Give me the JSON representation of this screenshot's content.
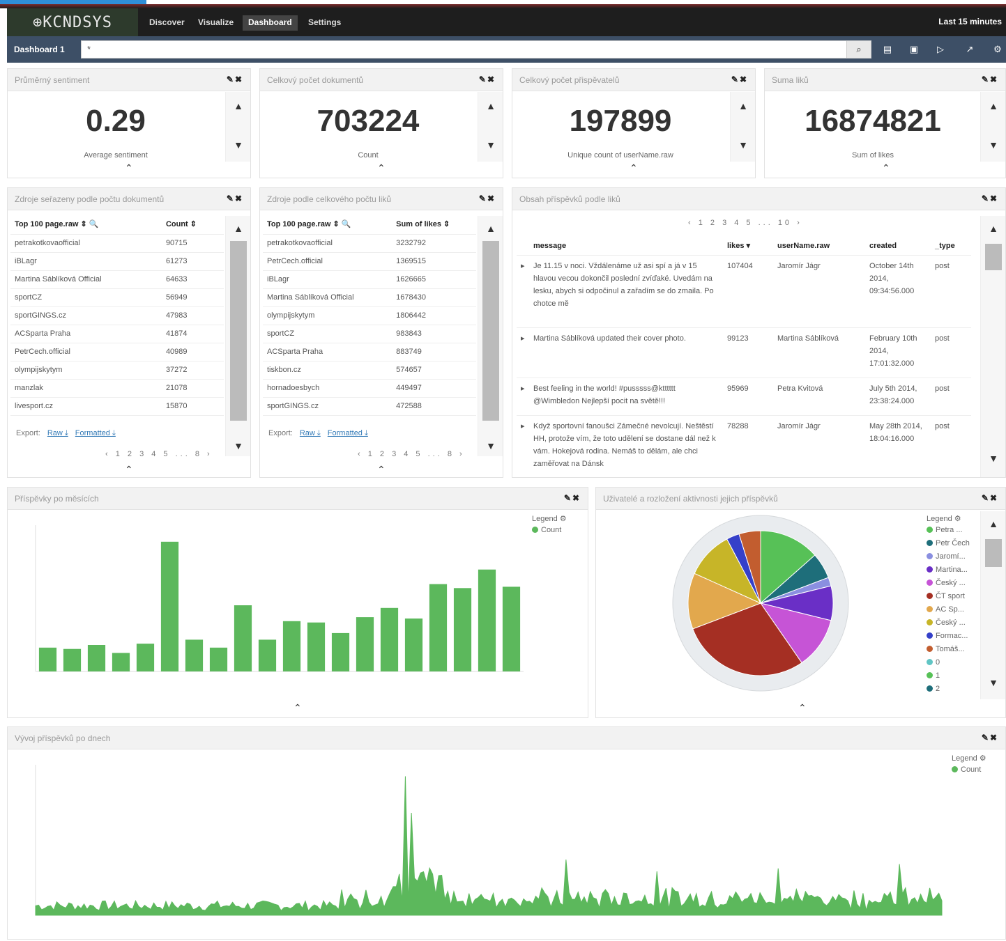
{
  "app": {
    "logo": "⊕KCNDSYS",
    "nav": [
      "Discover",
      "Visualize",
      "Dashboard",
      "Settings"
    ],
    "active_nav": "Dashboard",
    "time_label": "Last 15 minutes",
    "dashboard_name": "Dashboard 1",
    "search_value": "*",
    "toolbar_icons": [
      "new-dashboard-icon",
      "save-icon",
      "load-icon",
      "share-icon",
      "settings-icon"
    ]
  },
  "metrics": [
    {
      "title": "Průměrný sentiment",
      "value": "0.29",
      "label": "Average sentiment"
    },
    {
      "title": "Celkový počet dokumentů",
      "value": "703224",
      "label": "Count"
    },
    {
      "title": "Celkový počet přispěvatelů",
      "value": "197899",
      "label": "Unique count of userName.raw"
    },
    {
      "title": "Suma liků",
      "value": "16874821",
      "label": "Sum of likes"
    }
  ],
  "sources_by_docs": {
    "title": "Zdroje seřazeny podle počtu dokumentů",
    "columns": [
      "Top 100 page.raw ⇕ 🔍",
      "Count ⇕"
    ],
    "rows": [
      [
        "petrakotkovaofficial",
        "90715"
      ],
      [
        "iBLagr",
        "61273"
      ],
      [
        "Martina Sáblíková Official",
        "64633"
      ],
      [
        "sportCZ",
        "56949"
      ],
      [
        "sportGINGS.cz",
        "47983"
      ],
      [
        "ACSparta Praha",
        "41874"
      ],
      [
        "PetrCech.official",
        "40989"
      ],
      [
        "olympijskytym",
        "37272"
      ],
      [
        "manzlak",
        "21078"
      ],
      [
        "livesport.cz",
        "15870"
      ]
    ],
    "export_label": "Export:",
    "export_links": [
      "Raw ⤓",
      "Formatted ⤓"
    ],
    "pager": "‹ 1 2 3 4 5 ... 8 ›"
  },
  "sources_by_likes": {
    "title": "Zdroje podle celkového počtu liků",
    "columns": [
      "Top 100 page.raw ⇕ 🔍",
      "Sum of likes ⇕"
    ],
    "rows": [
      [
        "petrakotkovaofficial",
        "3232792"
      ],
      [
        "PetrCech.official",
        "1369515"
      ],
      [
        "iBLagr",
        "1626665"
      ],
      [
        "Martina Sáblíková Official",
        "1678430"
      ],
      [
        "olympijskytym",
        "1806442"
      ],
      [
        "sportCZ",
        "983843"
      ],
      [
        "ACSparta Praha",
        "883749"
      ],
      [
        "tiskbon.cz",
        "574657"
      ],
      [
        "hornadoesbych",
        "449497"
      ],
      [
        "sportGINGS.cz",
        "472588"
      ]
    ],
    "export_label": "Export:",
    "export_links": [
      "Raw ⤓",
      "Formatted ⤓"
    ],
    "pager": "‹ 1 2 3 4 5 ... 8 ›"
  },
  "posts": {
    "title": "Obsah příspěvků podle liků",
    "pager": "‹ 1 2 3 4 5 ... 10 ›",
    "columns": [
      "message",
      "likes ▾",
      "userName.raw",
      "created",
      "_type"
    ],
    "rows": [
      {
        "message": "Je 11.15 v noci. Vždálenáme už asi spí a já v 15 hlavou vecou dokončil poslední zvíďaké. Uvedám na lesku, abych si odpočinul a zařadím se do zmaila. Po chotce mě",
        "likes": "107404",
        "user": "Jaromír Jágr",
        "created": "October 14th 2014, 09:34:56.000",
        "type": "post"
      },
      {
        "message": "Martina Sáblíková updated their cover photo.",
        "likes": "99123",
        "user": "Martina Sáblíková",
        "created": "February 10th 2014, 17:01:32.000",
        "type": "post"
      },
      {
        "message": "Best feeling in the world! #pusssss@ktttttt @Wimbledon Nejlepší pocit na světě!!!",
        "likes": "95969",
        "user": "Petra Kvitová",
        "created": "July 5th 2014, 23:38:24.000",
        "type": "post"
      },
      {
        "message": "Když sportovní fanoušci Zámečné nevolcují. Neštěstí HH, protože vím, že toto udělení se dostane dál než k vám. Hokejová rodina. Nemáš to dělám, ale chci zaměřovat na Dánsk",
        "likes": "78288",
        "user": "Jaromír Jágr",
        "created": "May 28th 2014, 18:04:16.000",
        "type": "post"
      }
    ]
  },
  "monthly": {
    "title": "Příspěvky po měsících",
    "legend_title": "Legend ⚙",
    "legend": [
      "Count"
    ]
  },
  "pie": {
    "title": "Uživatelé a rozložení aktivnosti jejich příspěvků",
    "legend_title": "Legend ⚙",
    "legend": [
      "Petra ...",
      "Petr Čech",
      "Jaromí...",
      "Martina...",
      "Český ...",
      "ČT sport",
      "AC Sp...",
      "Český ...",
      "Formac...",
      "Tomáš...",
      "0",
      "1",
      "2"
    ]
  },
  "daily": {
    "title": "Vývoj příspěvků po dnech",
    "legend_title": "Legend ⚙",
    "legend": [
      "Count"
    ]
  },
  "colors": {
    "bar": "#5cb85c",
    "nav_bg": "#1e1e1e",
    "subbar": "#3d4f66",
    "accent_blue": "#2f8fd8",
    "pie_palette": [
      "#57c157",
      "#1e6e7a",
      "#8a8fe0",
      "#6a2fc6",
      "#c654d6",
      "#a52f23",
      "#e2a84d",
      "#c7b528",
      "#3540c9",
      "#c25d2f",
      "#60c5c4"
    ]
  },
  "chart_data": [
    {
      "type": "bar",
      "title": "Příspěvky po měsících",
      "series": [
        {
          "name": "Count",
          "values": [
            9,
            8.5,
            10,
            7,
            10.5,
            49,
            12,
            9,
            25,
            12,
            19,
            18.5,
            14.5,
            20.5,
            24,
            20,
            33,
            31.5,
            38.5,
            32
          ]
        }
      ],
      "ylim": [
        0,
        50
      ],
      "legend_position": "top-right"
    },
    {
      "type": "pie",
      "title": "Uživatelé a rozložení aktivnosti jejich příspěvků",
      "values": [
        14,
        6,
        2,
        8,
        12,
        30,
        13,
        11,
        3,
        5
      ]
    },
    {
      "type": "area",
      "title": "Vývoj příspěvků po dnech",
      "legend_position": "top-right",
      "ylim": [
        0,
        100
      ]
    }
  ]
}
